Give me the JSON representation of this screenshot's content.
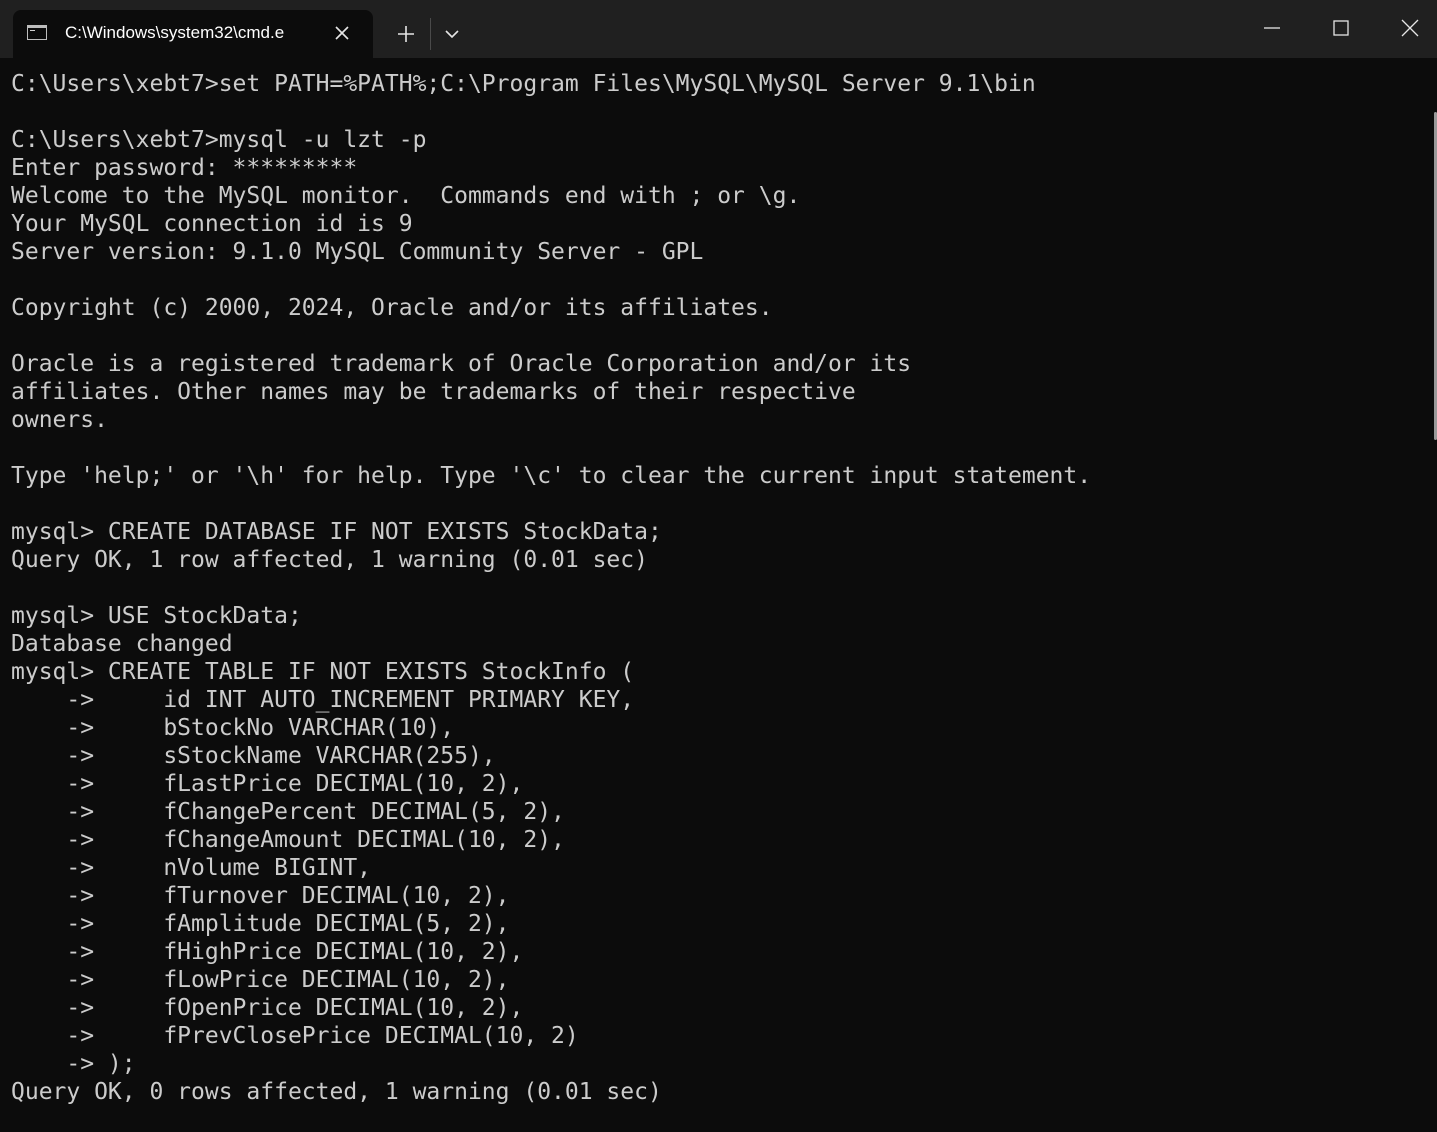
{
  "window": {
    "tab_title": "C:\\Windows\\system32\\cmd.e",
    "tab_icon": "terminal-icon",
    "new_tab_icon": "plus-icon",
    "dropdown_icon": "chevron-down-icon",
    "minimize_icon": "minimize-icon",
    "maximize_icon": "maximize-icon",
    "close_icon": "close-icon"
  },
  "colors": {
    "titlebar": "#202020",
    "background": "#0c0c0c",
    "text": "#cccccc"
  },
  "terminal": {
    "lines": [
      "C:\\Users\\xebt7>set PATH=%PATH%;C:\\Program Files\\MySQL\\MySQL Server 9.1\\bin",
      "",
      "C:\\Users\\xebt7>mysql -u lzt -p",
      "Enter password: *********",
      "Welcome to the MySQL monitor.  Commands end with ; or \\g.",
      "Your MySQL connection id is 9",
      "Server version: 9.1.0 MySQL Community Server - GPL",
      "",
      "Copyright (c) 2000, 2024, Oracle and/or its affiliates.",
      "",
      "Oracle is a registered trademark of Oracle Corporation and/or its",
      "affiliates. Other names may be trademarks of their respective",
      "owners.",
      "",
      "Type 'help;' or '\\h' for help. Type '\\c' to clear the current input statement.",
      "",
      "mysql> CREATE DATABASE IF NOT EXISTS StockData;",
      "Query OK, 1 row affected, 1 warning (0.01 sec)",
      "",
      "mysql> USE StockData;",
      "Database changed",
      "mysql> CREATE TABLE IF NOT EXISTS StockInfo (",
      "    ->     id INT AUTO_INCREMENT PRIMARY KEY,",
      "    ->     bStockNo VARCHAR(10),",
      "    ->     sStockName VARCHAR(255),",
      "    ->     fLastPrice DECIMAL(10, 2),",
      "    ->     fChangePercent DECIMAL(5, 2),",
      "    ->     fChangeAmount DECIMAL(10, 2),",
      "    ->     nVolume BIGINT,",
      "    ->     fTurnover DECIMAL(10, 2),",
      "    ->     fAmplitude DECIMAL(5, 2),",
      "    ->     fHighPrice DECIMAL(10, 2),",
      "    ->     fLowPrice DECIMAL(10, 2),",
      "    ->     fOpenPrice DECIMAL(10, 2),",
      "    ->     fPrevClosePrice DECIMAL(10, 2)",
      "    -> );",
      "Query OK, 0 rows affected, 1 warning (0.01 sec)"
    ]
  }
}
